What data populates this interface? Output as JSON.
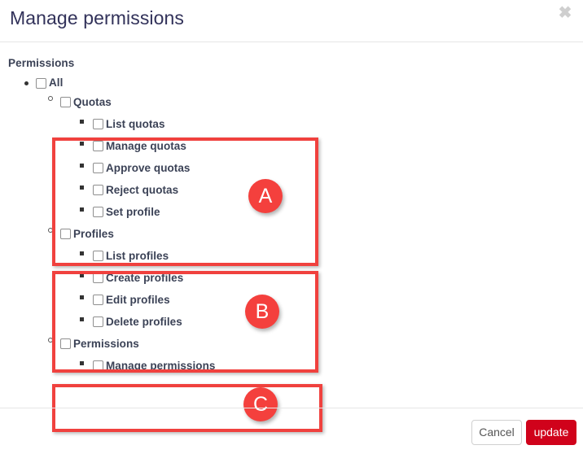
{
  "dialog": {
    "title": "Manage permissions",
    "close_icon": "close-icon",
    "section_label": "Permissions"
  },
  "tree": {
    "all": {
      "label": "All",
      "checked": false
    },
    "groups": [
      {
        "id": "quotas",
        "label": "Quotas",
        "checked": false,
        "badge": "A",
        "items": [
          {
            "label": "List quotas",
            "checked": false
          },
          {
            "label": "Manage quotas",
            "checked": false
          },
          {
            "label": "Approve quotas",
            "checked": false
          },
          {
            "label": "Reject quotas",
            "checked": false
          },
          {
            "label": "Set profile",
            "checked": false
          }
        ]
      },
      {
        "id": "profiles",
        "label": "Profiles",
        "checked": false,
        "badge": "B",
        "items": [
          {
            "label": "List profiles",
            "checked": false
          },
          {
            "label": "Create profiles",
            "checked": false
          },
          {
            "label": "Edit profiles",
            "checked": false
          },
          {
            "label": "Delete profiles",
            "checked": false
          }
        ]
      },
      {
        "id": "permissions",
        "label": "Permissions",
        "checked": false,
        "badge": "C",
        "items": [
          {
            "label": "Manage permissions",
            "checked": false
          }
        ]
      }
    ]
  },
  "footer": {
    "cancel_label": "Cancel",
    "update_label": "update"
  },
  "colors": {
    "annotation_red": "#f0413e",
    "badge_red": "#f4403d",
    "update_button_red": "#d0021b",
    "text_dark": "#3b4256",
    "title_color": "#32325a",
    "divider": "#e6e6e6"
  }
}
